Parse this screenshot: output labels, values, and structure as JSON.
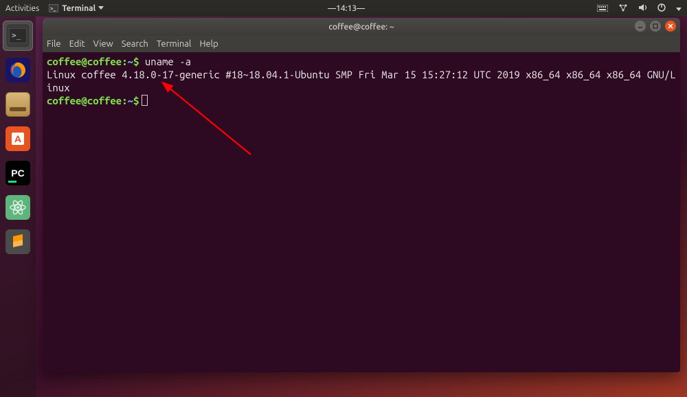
{
  "topbar": {
    "activities": "Activities",
    "app_menu": "Terminal",
    "clock": "14:13",
    "status_icons": [
      "keyboard-icon",
      "network-icon",
      "volume-icon",
      "power-icon",
      "chevron-down-icon"
    ]
  },
  "launcher": {
    "items": [
      {
        "name": "terminal",
        "active": true
      },
      {
        "name": "firefox",
        "active": false
      },
      {
        "name": "files",
        "active": false
      },
      {
        "name": "ubuntu-software",
        "active": false
      },
      {
        "name": "pycharm",
        "active": false
      },
      {
        "name": "atom",
        "active": false
      },
      {
        "name": "sublime-text",
        "active": false
      }
    ]
  },
  "window": {
    "title": "coffee@coffee: ~",
    "menubar": [
      "File",
      "Edit",
      "View",
      "Search",
      "Terminal",
      "Help"
    ],
    "controls": [
      "minimize",
      "maximize",
      "close"
    ]
  },
  "terminal": {
    "ps1_user_host": "coffee@coffee",
    "ps1_path": "~",
    "ps1_symbol": "$",
    "commands": [
      {
        "cmd": "uname -a",
        "output": "Linux coffee 4.18.0-17-generic #18~18.04.1-Ubuntu SMP Fri Mar 15 15:27:12 UTC 2019 x86_64 x86_64 x86_64 GNU/Linux"
      }
    ]
  }
}
